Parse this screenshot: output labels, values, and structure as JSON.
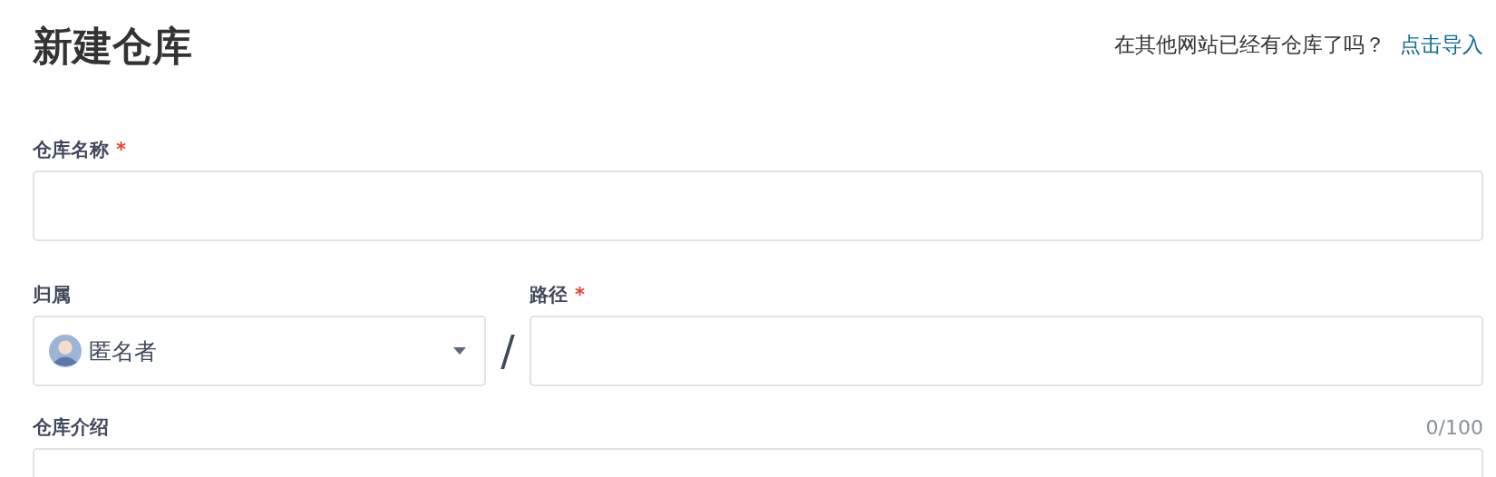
{
  "header": {
    "title": "新建仓库",
    "import_prompt": "在其他网站已经有仓库了吗？",
    "import_link": "点击导入"
  },
  "name_field": {
    "label": "仓库名称",
    "required": true,
    "required_mark": "*"
  },
  "owner_field": {
    "label": "归属",
    "value": "匿名者"
  },
  "separator": "/",
  "path_field": {
    "label": "路径",
    "required": true,
    "required_mark": "*"
  },
  "description_field": {
    "label": "仓库介绍",
    "counter": "0/100"
  }
}
